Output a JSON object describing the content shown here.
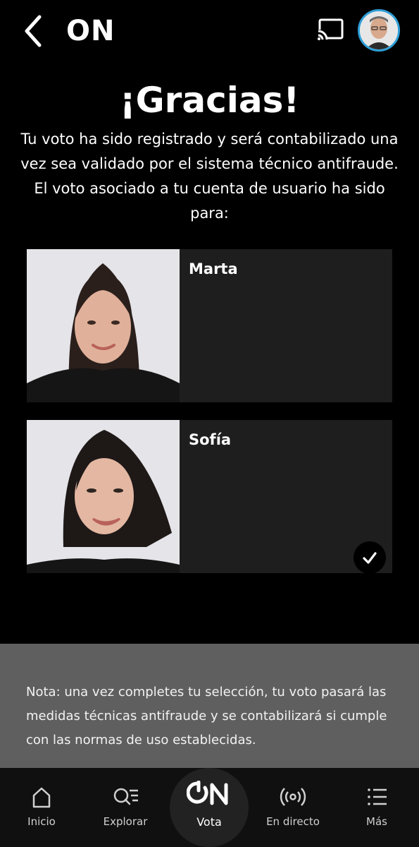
{
  "header": {
    "title": "ON",
    "icons": {
      "back": "back-chevron-icon",
      "cast": "cast-icon",
      "avatar": "user-avatar"
    }
  },
  "thanks": {
    "title": "¡Gracias!",
    "message": "Tu voto ha sido registrado y será contabilizado una vez sea validado por el sistema técnico antifraude. El voto asociado a tu cuenta de usuario ha sido para:"
  },
  "candidates": [
    {
      "name": "Marta",
      "selected": false
    },
    {
      "name": "Sofía",
      "selected": true
    }
  ],
  "note": {
    "text": "Nota: una vez completes tu selección, tu voto pasará las medidas técnicas antifraude y se contabilizará si cumple con las normas de uso establecidas."
  },
  "nav": {
    "items": [
      {
        "label": "Inicio",
        "icon": "home-icon"
      },
      {
        "label": "Explorar",
        "icon": "explore-icon"
      },
      {
        "label": "Vota",
        "icon": "on-logo"
      },
      {
        "label": "En directo",
        "icon": "live-icon"
      },
      {
        "label": "Más",
        "icon": "menu-icon"
      }
    ]
  },
  "colors": {
    "background": "#000000",
    "card": "#1e1e1e",
    "note": "#5f5f5f",
    "avatar_ring": "#2f9fd8"
  }
}
